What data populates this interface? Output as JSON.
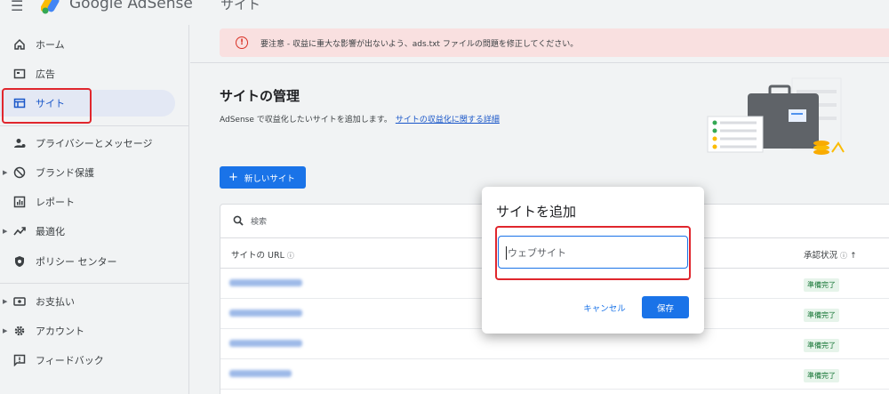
{
  "header": {
    "menu_icon": "hamburger-icon",
    "brand": "Google AdSense",
    "page_title": "サイト"
  },
  "sidebar": {
    "items": [
      {
        "label": "ホーム",
        "icon": "home-icon"
      },
      {
        "label": "広告",
        "icon": "ads-icon"
      },
      {
        "label": "サイト",
        "icon": "sites-icon",
        "active": true
      },
      {
        "label": "プライバシーとメッセージ",
        "icon": "privacy-icon"
      },
      {
        "label": "ブランド保護",
        "icon": "block-icon"
      },
      {
        "label": "レポート",
        "icon": "report-icon"
      },
      {
        "label": "最適化",
        "icon": "trend-icon"
      },
      {
        "label": "ポリシー センター",
        "icon": "shield-icon"
      },
      {
        "label": "お支払い",
        "icon": "payments-icon"
      },
      {
        "label": "アカウント",
        "icon": "gear-icon"
      },
      {
        "label": "フィードバック",
        "icon": "feedback-icon"
      }
    ]
  },
  "alert": {
    "icon": "warning-icon",
    "text": "要注意 - 収益に重大な影響が出ないよう、ads.txt ファイルの問題を修正してください。"
  },
  "main": {
    "title": "サイトの管理",
    "description": "AdSense で収益化したいサイトを追加します。",
    "link": "サイトの収益化に関する詳細",
    "new_site_button": "新しいサイト"
  },
  "table": {
    "search_label": "検索",
    "col_url": "サイトの URL",
    "col_status": "承認状況",
    "rows": [
      {
        "status": "準備完了"
      },
      {
        "status": "準備完了"
      },
      {
        "status": "準備完了"
      },
      {
        "status": "準備完了"
      }
    ]
  },
  "dialog": {
    "title": "サイトを追加",
    "input_placeholder": "ウェブサイト",
    "cancel_label": "キャンセル",
    "save_label": "保存"
  },
  "colors": {
    "primary": "#1a73e8",
    "active_nav_bg": "#e3e8f4",
    "alert_bg": "#f9e0e0",
    "ready_badge_bg": "#e6f4ea",
    "ready_badge_text": "#137333",
    "highlight_red": "#e0262d"
  }
}
